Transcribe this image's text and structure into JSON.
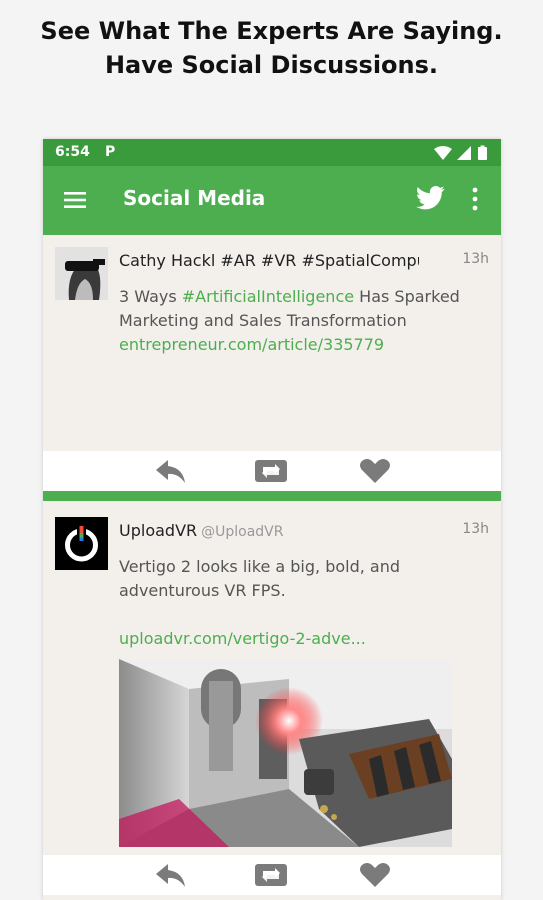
{
  "headline": {
    "line1": "See What The Experts Are Saying.",
    "line2": "Have Social Discussions."
  },
  "status_bar": {
    "time": "6:54",
    "app_indicator": "P",
    "icons": [
      "wifi-icon",
      "cellular-signal-icon",
      "battery-icon"
    ]
  },
  "app_bar": {
    "title": "Social Media",
    "icons": [
      "hamburger-menu-icon",
      "twitter-bird-icon",
      "more-vert-icon"
    ]
  },
  "colors": {
    "status_bar": "#3a9b3c",
    "app_bar": "#4cae4f",
    "accent": "#4cae4f",
    "card_bg": "#f3f0ec",
    "action_bar_bg": "#ffffff",
    "action_icon": "#7b7b7b"
  },
  "tweets": [
    {
      "author": "Cathy Hackl #AR #VR #SpatialComputing",
      "handle": "",
      "time": "13h",
      "text_before": "3 Ways ",
      "hashtag": "#ArtificialIntelligence",
      "text_after": " Has Sparked Marketing and Sales Transformation",
      "link": "entrepreneur.com/article/335779"
    },
    {
      "author": "UploadVR",
      "handle": "@UploadVR",
      "time": "13h",
      "text": "Vertigo 2 looks like a big, bold, and adventurous VR FPS.",
      "link": "uploadvr.com/vertigo-2-adve..."
    }
  ],
  "actions": [
    "reply-icon",
    "retweet-icon",
    "like-icon"
  ]
}
